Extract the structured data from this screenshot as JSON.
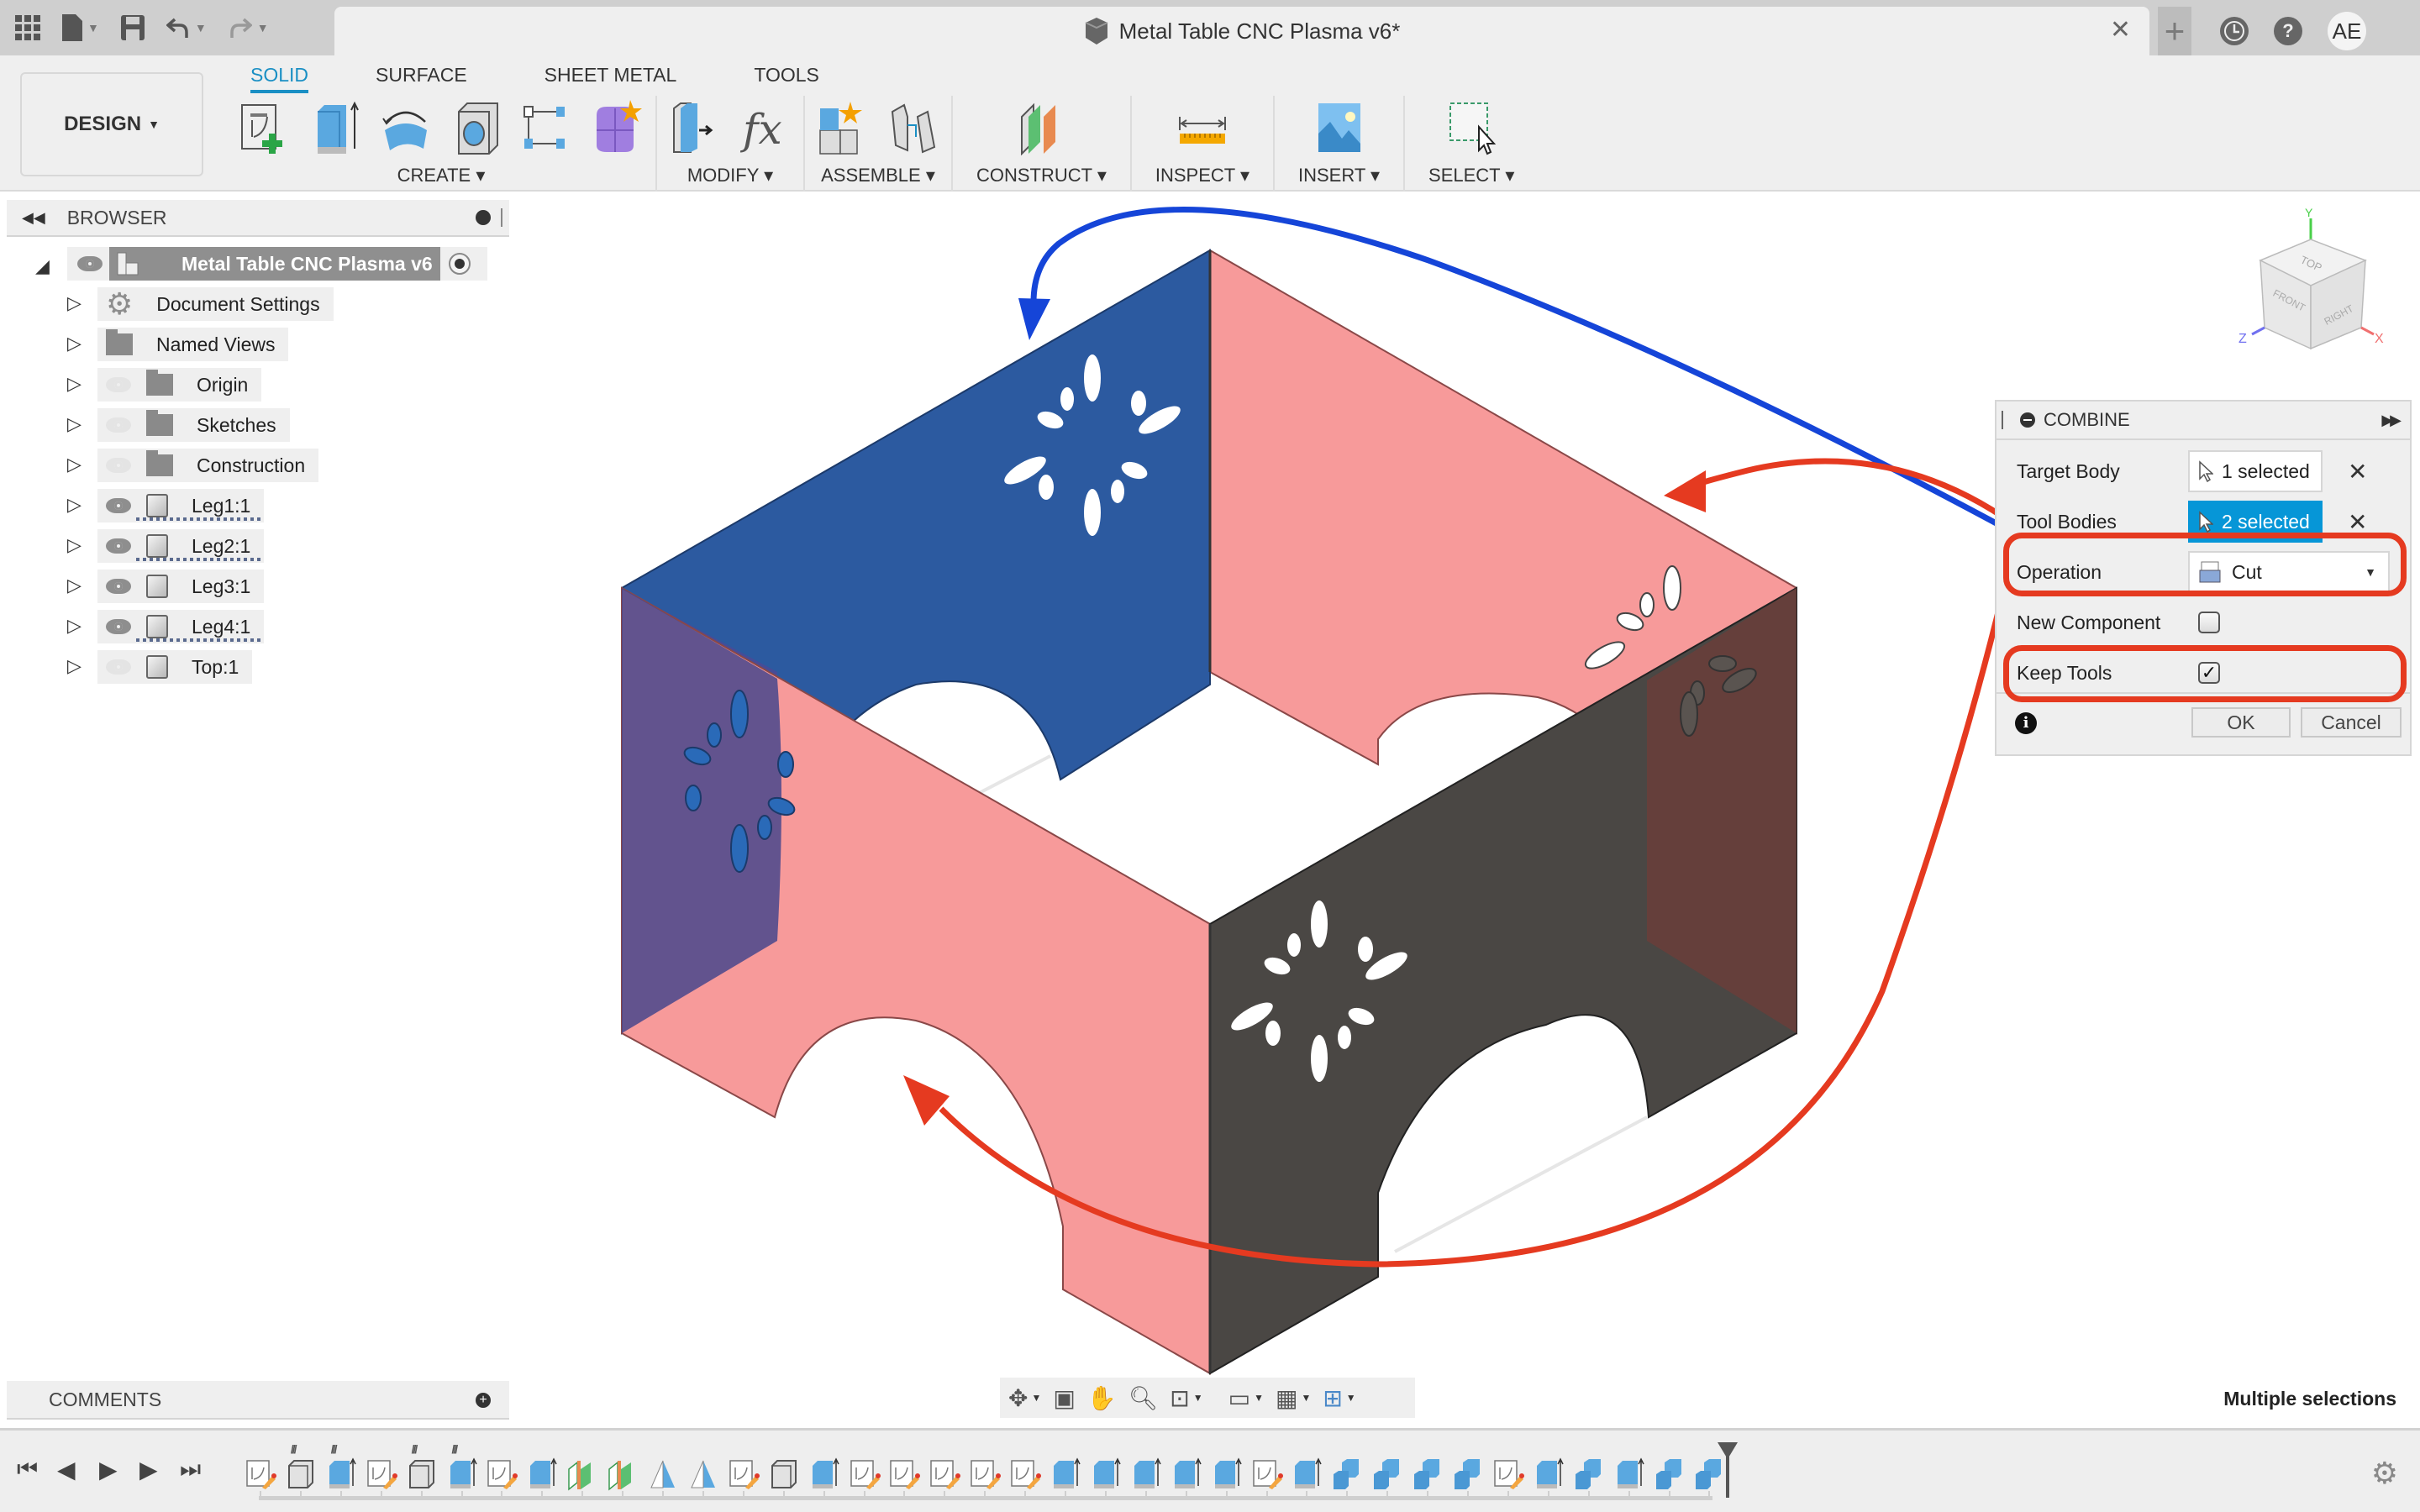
{
  "titlebar": {
    "doc_title": "Metal Table CNC Plasma v6*",
    "avatar_initials": "AE",
    "icons": [
      "app-grid-icon",
      "file-icon",
      "save-icon",
      "undo-icon",
      "redo-icon",
      "close-icon",
      "new-tab-icon",
      "job-status-icon",
      "help-icon"
    ]
  },
  "ribbon": {
    "workspace": "DESIGN",
    "tabs": [
      {
        "label": "SOLID",
        "active": true
      },
      {
        "label": "SURFACE",
        "active": false
      },
      {
        "label": "SHEET METAL",
        "active": false
      },
      {
        "label": "TOOLS",
        "active": false
      }
    ],
    "groups": [
      {
        "label": "CREATE",
        "icons": [
          "create-sketch-icon",
          "extrude-icon",
          "revolve-icon",
          "hole-icon",
          "pattern-icon",
          "create-form-icon"
        ]
      },
      {
        "label": "MODIFY",
        "icons": [
          "press-pull-icon",
          "parameters-icon"
        ]
      },
      {
        "label": "ASSEMBLE",
        "icons": [
          "new-component-icon",
          "joint-icon"
        ]
      },
      {
        "label": "CONSTRUCT",
        "icons": [
          "offset-plane-icon"
        ]
      },
      {
        "label": "INSPECT",
        "icons": [
          "measure-icon"
        ]
      },
      {
        "label": "INSERT",
        "icons": [
          "insert-image-icon"
        ]
      },
      {
        "label": "SELECT",
        "icons": [
          "select-window-icon"
        ]
      }
    ]
  },
  "browser": {
    "title": "BROWSER",
    "root": "Metal Table CNC Plasma v6",
    "items": [
      {
        "label": "Document Settings",
        "icon": "gear-icon",
        "visible": null
      },
      {
        "label": "Named Views",
        "icon": "folder-icon",
        "visible": null
      },
      {
        "label": "Origin",
        "icon": "folder-icon",
        "visible": false
      },
      {
        "label": "Sketches",
        "icon": "folder-icon",
        "visible": false
      },
      {
        "label": "Construction",
        "icon": "folder-icon",
        "visible": false
      },
      {
        "label": "Leg1:1",
        "icon": "body-icon",
        "visible": true,
        "modified": true
      },
      {
        "label": "Leg2:1",
        "icon": "body-icon",
        "visible": true,
        "modified": true
      },
      {
        "label": "Leg3:1",
        "icon": "body-icon",
        "visible": true,
        "modified": false
      },
      {
        "label": "Leg4:1",
        "icon": "body-icon",
        "visible": true,
        "modified": true
      },
      {
        "label": "Top:1",
        "icon": "body-icon",
        "visible": false,
        "modified": false
      }
    ]
  },
  "comments": {
    "title": "COMMENTS"
  },
  "combine": {
    "title": "COMBINE",
    "target_body_label": "Target Body",
    "target_body_value": "1 selected",
    "tool_bodies_label": "Tool Bodies",
    "tool_bodies_value": "2 selected",
    "operation_label": "Operation",
    "operation_value": "Cut",
    "new_component_label": "New Component",
    "new_component_checked": false,
    "keep_tools_label": "Keep Tools",
    "keep_tools_checked": true,
    "ok_label": "OK",
    "cancel_label": "Cancel"
  },
  "viewcube": {
    "faces": [
      "TOP",
      "FRONT",
      "RIGHT"
    ],
    "axes": [
      "Y",
      "Z",
      "X"
    ]
  },
  "status": {
    "text": "Multiple selections"
  },
  "colors": {
    "accent": "#0696d7",
    "tab_active": "#1a8fc4",
    "annotation_red": "#e53a20",
    "annotation_blue": "#1545d8",
    "target_body": "#2c5aa0",
    "tool_body": "#f79a9a",
    "other_body": "#4a4744"
  },
  "navbar": {
    "icons": [
      "orbit-icon",
      "look-at-icon",
      "pan-icon",
      "zoom-icon",
      "fit-icon",
      "display-settings-icon",
      "grid-icon",
      "viewports-icon"
    ]
  },
  "timeline": {
    "controls": [
      "go-to-start-icon",
      "step-back-icon",
      "play-icon",
      "step-forward-icon",
      "go-to-end-icon"
    ],
    "features": [
      "sketch",
      "body",
      "extrude",
      "sketch",
      "body",
      "extrude",
      "sketch",
      "extrude",
      "plane",
      "plane",
      "axis",
      "axis",
      "sketch",
      "body",
      "extrude",
      "sketch",
      "sketch",
      "sketch",
      "sketch",
      "sketch",
      "extrude",
      "extrude",
      "extrude",
      "extrude",
      "extrude",
      "sketch",
      "extrude",
      "combine",
      "combine",
      "combine",
      "combine",
      "sketch",
      "extrude",
      "combine",
      "extrude",
      "combine",
      "combine"
    ],
    "grouped_markers": [
      1,
      2,
      4,
      5
    ]
  }
}
